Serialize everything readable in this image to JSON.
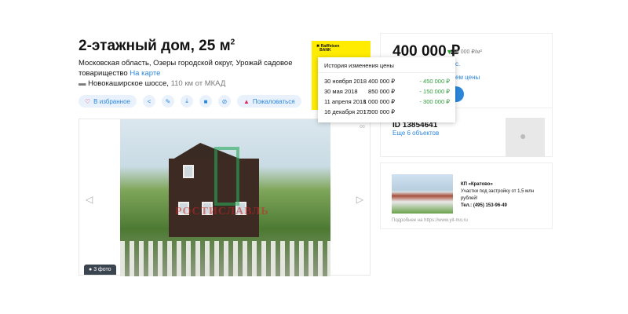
{
  "listing": {
    "title": "2-этажный дом, 25 м",
    "title_sup": "2",
    "address": "Московская область, Озеры городской округ, Урожай садовое товарищество",
    "map_link": "На карте",
    "road": "Новокаширское шоссе,",
    "distance": "110 км от МКАД",
    "actions": {
      "favorite": "В избранное",
      "report": "Пожаловаться"
    },
    "photo_count": "3 фото",
    "watermark": "РОСТИСЛАВЛЬ"
  },
  "ad": {
    "brand": "Райффайзен БАНК"
  },
  "price_card": {
    "price": "400 000 ₽",
    "per_meter": "16 000 ₽/м²",
    "partial_link_1": "с.",
    "partial_link_2": "ем цены",
    "id": "ID 13854641",
    "more_objects": "Еще 6 объектов"
  },
  "price_history": {
    "title": "История изменения цены",
    "rows": [
      {
        "date": "30 ноября 2018",
        "price": "400 000 ₽",
        "change": "- 450 000 ₽"
      },
      {
        "date": "30 мая 2018",
        "price": "850 000 ₽",
        "change": "- 150 000 ₽"
      },
      {
        "date": "11 апреля 2018",
        "price": "1 000 000 ₽",
        "change": "- 300 000 ₽"
      },
      {
        "date": "16 декабря 2017",
        "price": "1 300 000 ₽",
        "change": ""
      }
    ]
  },
  "promo": {
    "name": "КП «Кратово»",
    "text": "Участки под застройку от 1,5 млн рублей!",
    "phone": "Тел.: (495) 153-96-49",
    "more": "Подробнее на https://www.yit-mo.ru"
  }
}
